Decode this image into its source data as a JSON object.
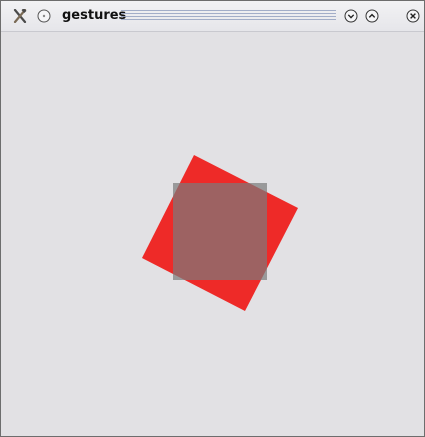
{
  "window": {
    "title": "gestures"
  },
  "titlebar": {
    "icons": [
      "window-menu-icon",
      "sticky-icon",
      "shade-icon",
      "maximize-icon",
      "close-icon"
    ]
  },
  "canvas": {
    "background_color": "#e2e1e4",
    "rotated_square": {
      "color": "#ee2a28",
      "rotation_deg": 30
    },
    "overlay_square": {
      "color": "#7a7a7a",
      "opacity": 0.7
    }
  }
}
